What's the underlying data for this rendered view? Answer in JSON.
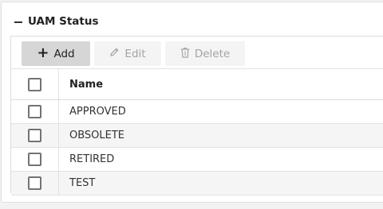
{
  "section": {
    "title": "UAM Status",
    "collapse_icon": "minus-icon"
  },
  "toolbar": {
    "add_label": "Add",
    "edit_label": "Edit",
    "delete_label": "Delete",
    "add_icon": "plus-icon",
    "edit_icon": "pencil-icon",
    "delete_icon": "trash-icon"
  },
  "table": {
    "columns": [
      "Name"
    ],
    "rows": [
      {
        "name": "APPROVED",
        "checked": false
      },
      {
        "name": "OBSOLETE",
        "checked": false
      },
      {
        "name": "RETIRED",
        "checked": false
      },
      {
        "name": "TEST",
        "checked": false
      }
    ]
  },
  "colors": {
    "primary_button_bg": "#d6d6d6",
    "disabled_text": "#a3a3a3",
    "checkbox_border": "#737373"
  }
}
